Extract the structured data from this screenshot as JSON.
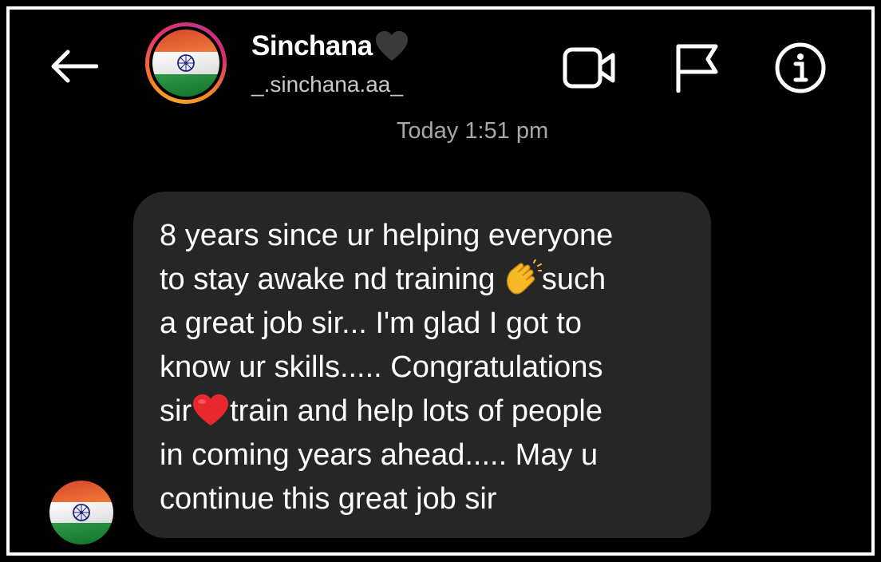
{
  "header": {
    "back_label": "Back",
    "contact_name": "Sinchana",
    "contact_name_emoji": "black-heart",
    "username": "_.sinchana.aa_",
    "icons": [
      "back-arrow-icon",
      "video-call-icon",
      "flag-icon",
      "info-icon"
    ]
  },
  "chat": {
    "timestamp": "Today 1:51 pm",
    "message": {
      "line1": "8 years since ur helping everyone",
      "line2_a": "to stay awake nd training ",
      "line2_emoji": "clapping-hands-icon",
      "line2_b": "such",
      "line3": "a great job sir... I'm glad I got to",
      "line4": "know ur skills..... Congratulations",
      "line5_a": "sir",
      "line5_emoji": "red-heart-icon",
      "line5_b": "train and help lots of people",
      "line6": "in coming years ahead..... May u",
      "line7": "continue this great job sir"
    }
  },
  "colors": {
    "background": "#000000",
    "bubble": "#262626",
    "secondary_text": "#a8a8a8",
    "flag_saffron": "#e25b2e",
    "flag_green": "#1f8a3a",
    "chakra": "#1a237e"
  }
}
